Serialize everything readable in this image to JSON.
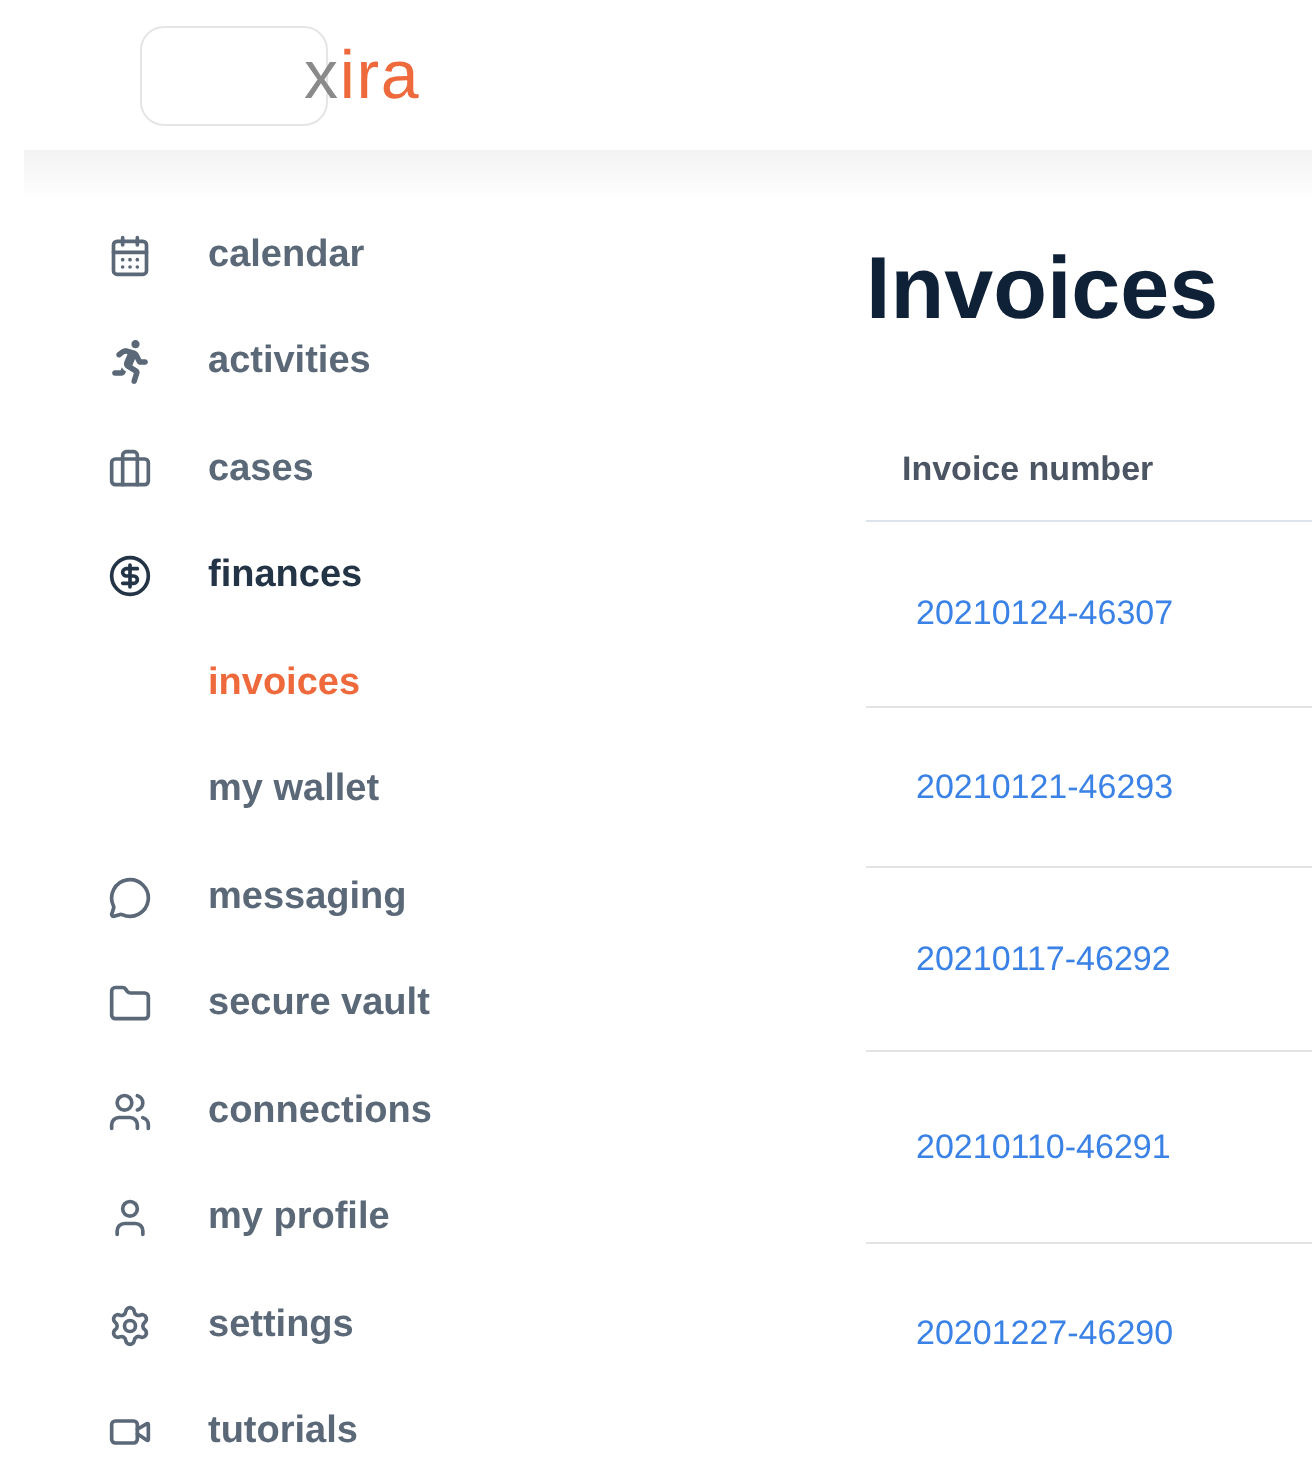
{
  "logo": {
    "text": "xira"
  },
  "sidebar": {
    "items": [
      {
        "label": "calendar",
        "expanded": false
      },
      {
        "label": "activities",
        "expanded": false
      },
      {
        "label": "cases",
        "expanded": false
      },
      {
        "label": "finances",
        "expanded": true,
        "children": [
          {
            "label": "invoices",
            "selected": true
          },
          {
            "label": "my wallet",
            "selected": false
          }
        ]
      },
      {
        "label": "messaging",
        "expanded": false
      },
      {
        "label": "secure vault",
        "expanded": false
      },
      {
        "label": "connections",
        "expanded": false
      },
      {
        "label": "my profile",
        "expanded": false
      },
      {
        "label": "settings",
        "expanded": false
      },
      {
        "label": "tutorials",
        "expanded": false
      }
    ]
  },
  "page": {
    "title": "Invoices"
  },
  "table": {
    "columns": [
      "Invoice number"
    ],
    "rows": [
      [
        "20210124-46307"
      ],
      [
        "20210121-46293"
      ],
      [
        "20210117-46292"
      ],
      [
        "20210110-46291"
      ],
      [
        "20201227-46290"
      ]
    ]
  }
}
